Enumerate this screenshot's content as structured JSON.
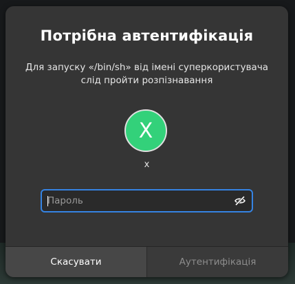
{
  "dialog": {
    "title": "Потрібна автентифікація",
    "description": "Для запуску «/bin/sh» від імені суперкористувача слід пройти розпізнавання"
  },
  "user": {
    "avatar_initial": "X",
    "avatar_color": "#33d17a",
    "name": "x"
  },
  "password": {
    "placeholder": "Пароль",
    "value": "",
    "toggle_icon": "eye-slash-icon"
  },
  "buttons": {
    "cancel_label": "Скасувати",
    "authenticate_label": "Аутентифікація"
  },
  "colors": {
    "accent": "#3584e4",
    "dialog_bg": "#353535"
  }
}
